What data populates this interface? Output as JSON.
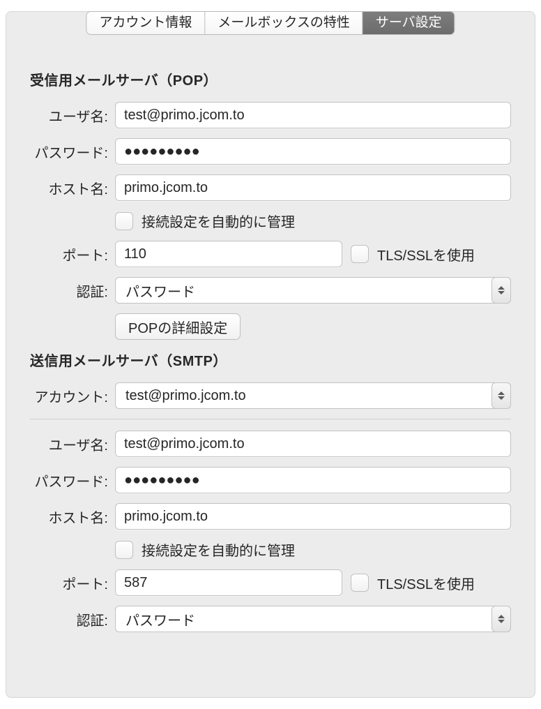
{
  "tabs": {
    "account_info": "アカウント情報",
    "mailbox_behaviors": "メールボックスの特性",
    "server_settings": "サーバ設定"
  },
  "incoming": {
    "title": "受信用メールサーバ（POP）",
    "username_label": "ユーザ名:",
    "username_value": "test@primo.jcom.to",
    "password_label": "パスワード:",
    "password_value": "●●●●●●●●●",
    "host_label": "ホスト名:",
    "host_value": "primo.jcom.to",
    "auto_manage_label": "接続設定を自動的に管理",
    "port_label": "ポート:",
    "port_value": "110",
    "tlsssl_label": "TLS/SSLを使用",
    "auth_label": "認証:",
    "auth_value": "パスワード",
    "advanced_button": "POPの詳細設定"
  },
  "outgoing": {
    "title": "送信用メールサーバ（SMTP）",
    "account_label": "アカウント:",
    "account_value": "test@primo.jcom.to",
    "username_label": "ユーザ名:",
    "username_value": "test@primo.jcom.to",
    "password_label": "パスワード:",
    "password_value": "●●●●●●●●●",
    "host_label": "ホスト名:",
    "host_value": "primo.jcom.to",
    "auto_manage_label": "接続設定を自動的に管理",
    "port_label": "ポート:",
    "port_value": "587",
    "tlsssl_label": "TLS/SSLを使用",
    "auth_label": "認証:",
    "auth_value": "パスワード"
  }
}
